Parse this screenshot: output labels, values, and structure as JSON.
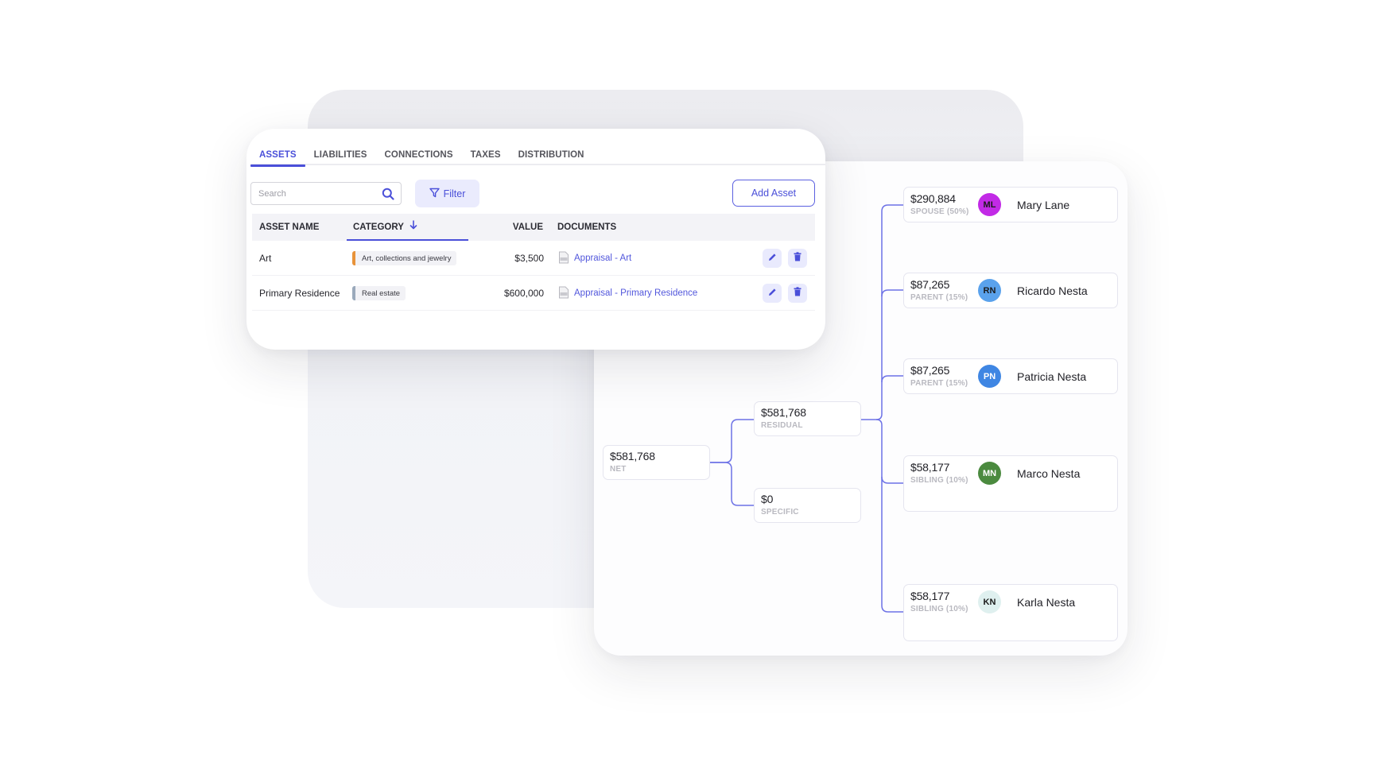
{
  "colors": {
    "accent": "#4a4fd9",
    "link_line": "#6d72e6"
  },
  "assets_panel": {
    "tabs": [
      {
        "label": "ASSETS",
        "active": true
      },
      {
        "label": "LIABILITIES",
        "active": false
      },
      {
        "label": "CONNECTIONS",
        "active": false
      },
      {
        "label": "TAXES",
        "active": false
      },
      {
        "label": "DISTRIBUTION",
        "active": false
      }
    ],
    "search": {
      "placeholder": "Search",
      "value": "",
      "icon": "search-icon"
    },
    "filter_label": "Filter",
    "add_asset_label": "Add Asset",
    "table": {
      "columns": [
        "ASSET NAME",
        "CATEGORY",
        "VALUE",
        "DOCUMENTS"
      ],
      "sorted_column": "CATEGORY",
      "sort_direction": "descending",
      "rows": [
        {
          "name": "Art",
          "category": "Art, collections and jewelry",
          "category_color": "#e8933a",
          "value": "$3,500",
          "document": "Appraisal - Art"
        },
        {
          "name": "Primary Residence",
          "category": "Real estate",
          "category_color": "#9aa9bb",
          "value": "$600,000",
          "document": "Appraisal - Primary Residence"
        }
      ]
    }
  },
  "distribution_tree": {
    "net": {
      "amount": "$581,768",
      "label": "NET"
    },
    "residual": {
      "amount": "$581,768",
      "label": "RESIDUAL"
    },
    "specific": {
      "amount": "$0",
      "label": "SPECIFIC"
    },
    "heirs": [
      {
        "amount": "$290,884",
        "relation": "SPOUSE (50%)",
        "initials": "ML",
        "name": "Mary Lane",
        "avatar_bg": "#c22ae6",
        "avatar_fg": "#1a1a1a"
      },
      {
        "amount": "$87,265",
        "relation": "PARENT (15%)",
        "initials": "RN",
        "name": "Ricardo Nesta",
        "avatar_bg": "#5aa2ec",
        "avatar_fg": "#1a1a1a"
      },
      {
        "amount": "$87,265",
        "relation": "PARENT (15%)",
        "initials": "PN",
        "name": "Patricia Nesta",
        "avatar_bg": "#3f86e3",
        "avatar_fg": "#ffffff"
      },
      {
        "amount": "$58,177",
        "relation": "SIBLING (10%)",
        "initials": "MN",
        "name": "Marco Nesta",
        "avatar_bg": "#4b8a3f",
        "avatar_fg": "#ffffff"
      },
      {
        "amount": "$58,177",
        "relation": "SIBLING (10%)",
        "initials": "KN",
        "name": "Karla Nesta",
        "avatar_bg": "#dff0ef",
        "avatar_fg": "#1a1a1a"
      }
    ]
  }
}
